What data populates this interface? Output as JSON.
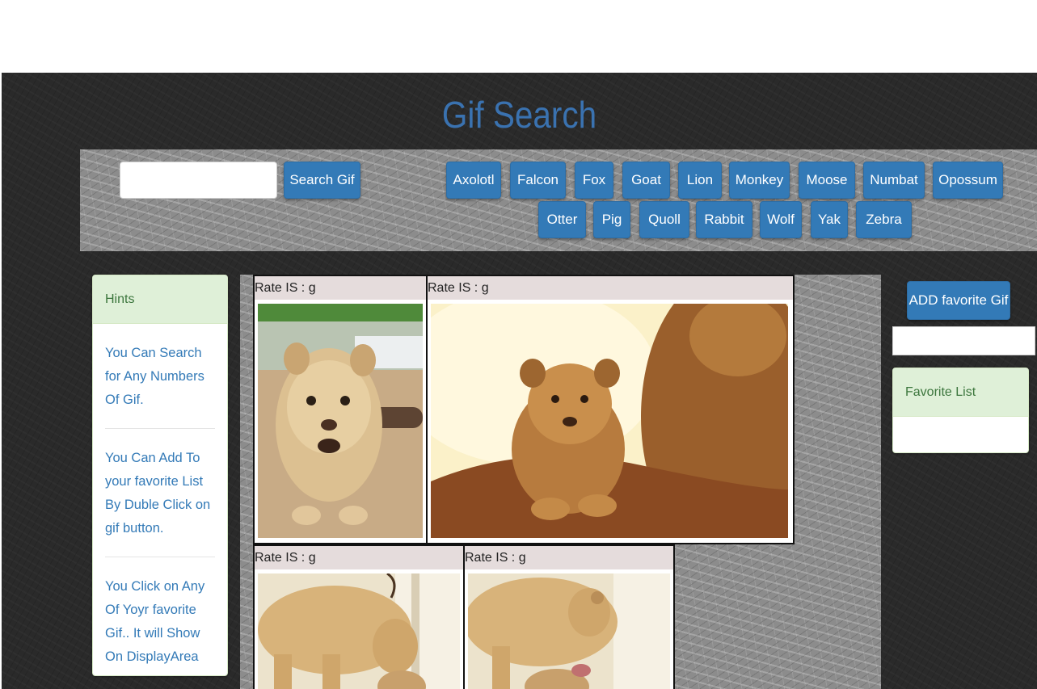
{
  "header": {
    "title": "Gif Search"
  },
  "search": {
    "input_value": "",
    "button_label": "Search Gif"
  },
  "animals": [
    "Axolotl",
    "Falcon",
    "Fox",
    "Goat",
    "Lion",
    "Monkey",
    "Moose",
    "Numbat",
    "Opossum",
    "Otter",
    "Pig",
    "Quoll",
    "Rabbit",
    "Wolf",
    "Yak",
    "Zebra"
  ],
  "hints": {
    "title": "Hints",
    "items": [
      "You Can Search for Any Numbers Of Gif.",
      "You Can Add To your favorite List By Duble Click on gif button.",
      "You Click on Any Of Yoyr favorite Gif.. It will Show On DisplayArea"
    ]
  },
  "gifs": [
    {
      "rating": "Rate IS : g",
      "image": "lion-cub-walking"
    },
    {
      "rating": "Rate IS : g",
      "image": "lion-cub-on-rock"
    },
    {
      "rating": "Rate IS : g",
      "image": "lioness-with-cub"
    },
    {
      "rating": "Rate IS : g",
      "image": "lioness-with-cub"
    }
  ],
  "favorites": {
    "add_button_label": "ADD favorite Gif",
    "input_value": "",
    "list_title": "Favorite List",
    "items": []
  },
  "colors": {
    "title": "#3a72b0",
    "button": "#337ab7",
    "panel_heading_bg": "#dff0d8",
    "panel_heading_text": "#3c763d",
    "hint_text": "#337ab7",
    "rating_bg": "#e5dcdc",
    "page_bg": "#2a2a2a"
  }
}
